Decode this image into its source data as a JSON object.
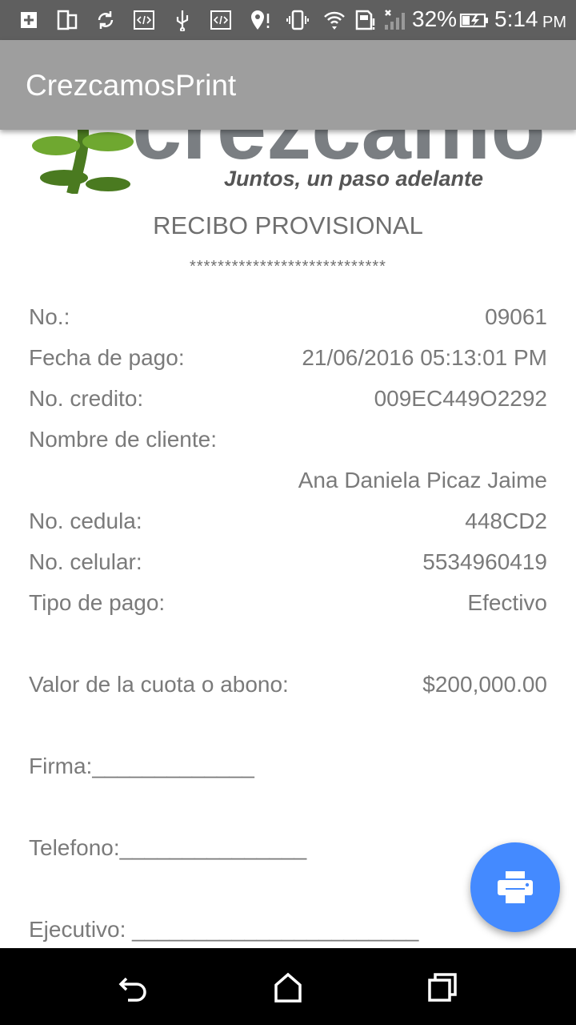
{
  "status_bar": {
    "battery_percent": "32%",
    "time": "5:14",
    "ampm": "PM",
    "icons": [
      "add-box-icon",
      "phone-tablet-icon",
      "sync-icon",
      "code-icon",
      "usb-icon",
      "code-icon",
      "location-alert-icon",
      "vibrate-icon",
      "wifi-icon",
      "sd-card-alert-icon",
      "signal-icon",
      "battery-charging-icon"
    ]
  },
  "app_bar": {
    "title": "CrezcamosPrint"
  },
  "logo": {
    "brand": "crezcamos",
    "tagline": "Juntos, un paso adelante"
  },
  "receipt": {
    "title": "RECIBO PROVISIONAL",
    "separator": "****************************",
    "fields": [
      {
        "label": "No.:",
        "value": "09061"
      },
      {
        "label": "Fecha de pago:",
        "value": "21/06/2016 05:13:01 PM"
      },
      {
        "label": "No. credito:",
        "value": "009EC449O2292"
      },
      {
        "label": "Nombre de cliente:",
        "value": "Ana Daniela Picaz Jaime"
      },
      {
        "label": "No. cedula:",
        "value": "448CD2"
      },
      {
        "label": "No. celular:",
        "value": "5534960419"
      },
      {
        "label": "Tipo de pago:",
        "value": "Efectivo"
      },
      {
        "label": "Valor de la cuota o abono:",
        "value": "$200,000.00"
      }
    ],
    "signature_lines": [
      "Firma:_____________",
      "Telefono:_______________",
      "Ejecutivo: _______________________"
    ]
  },
  "fab": {
    "icon": "print-icon"
  },
  "nav_bar": {
    "icons": [
      "back-icon",
      "home-icon",
      "recents-icon"
    ]
  },
  "colors": {
    "status_bar": "#5f5f5f",
    "app_bar": "#9e9e9e",
    "fab": "#448aff",
    "text": "#7a7a7a",
    "logo_green": "#6fa830"
  }
}
